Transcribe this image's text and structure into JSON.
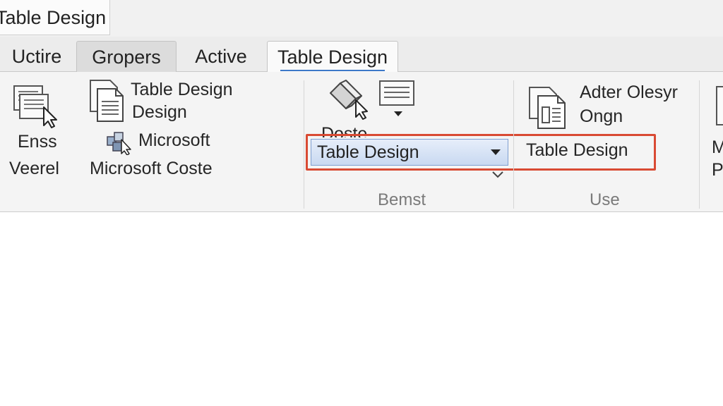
{
  "window": {
    "title": "Table Design"
  },
  "tabs": [
    {
      "label": "Uctire"
    },
    {
      "label": "Gropers"
    },
    {
      "label": "Active"
    },
    {
      "label": "Table Design"
    }
  ],
  "ribbon": {
    "group1": {
      "enss_line1": "Enss",
      "enss_line2": "Veerel",
      "table_design_line1": "Table Design",
      "table_design_line2": "Design",
      "microsoft_label": "Microsoft",
      "microsoft_coste_label": "Microsoft Coste"
    },
    "group2": {
      "paste_label": "Doste",
      "dropdown_value": "Table Design",
      "group_label": "Bemst"
    },
    "group3": {
      "adter_line1": "Adter Olesyr",
      "adter_line2": "Ongn",
      "table_design_label": "Table Design",
      "group_label": "Use"
    },
    "group4": {
      "line1": "M",
      "line2": "P"
    }
  },
  "colors": {
    "accent": "#3c78c8",
    "highlight_box": "#d94a33",
    "dropdown_fill": "#c9d9f1"
  }
}
